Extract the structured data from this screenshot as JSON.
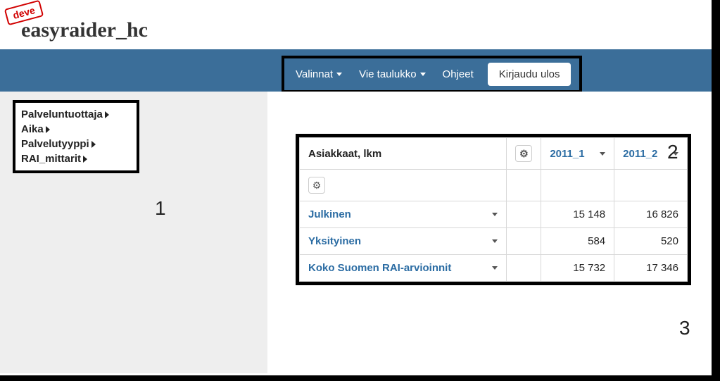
{
  "stamp": "deve",
  "app_title": "easyraider_hc",
  "nav": {
    "valinnat": "Valinnat",
    "vie": "Vie taulukko",
    "ohjeet": "Ohjeet",
    "logout": "Kirjaudu ulos"
  },
  "filters": {
    "items": [
      "Palveluntuottaja",
      "Aika",
      "Palvelutyyppi",
      "RAI_mittarit"
    ]
  },
  "annotations": {
    "one": "1",
    "two": "2",
    "three": "3"
  },
  "table": {
    "metric": "Asiakkaat, lkm",
    "cols": [
      "2011_1",
      "2011_2"
    ],
    "rows": [
      {
        "label": "Julkinen",
        "v1": "15 148",
        "v2": "16 826"
      },
      {
        "label": "Yksityinen",
        "v1": "584",
        "v2": "520"
      },
      {
        "label": "Koko Suomen RAI-arvioinnit",
        "v1": "15 732",
        "v2": "17 346"
      }
    ]
  }
}
